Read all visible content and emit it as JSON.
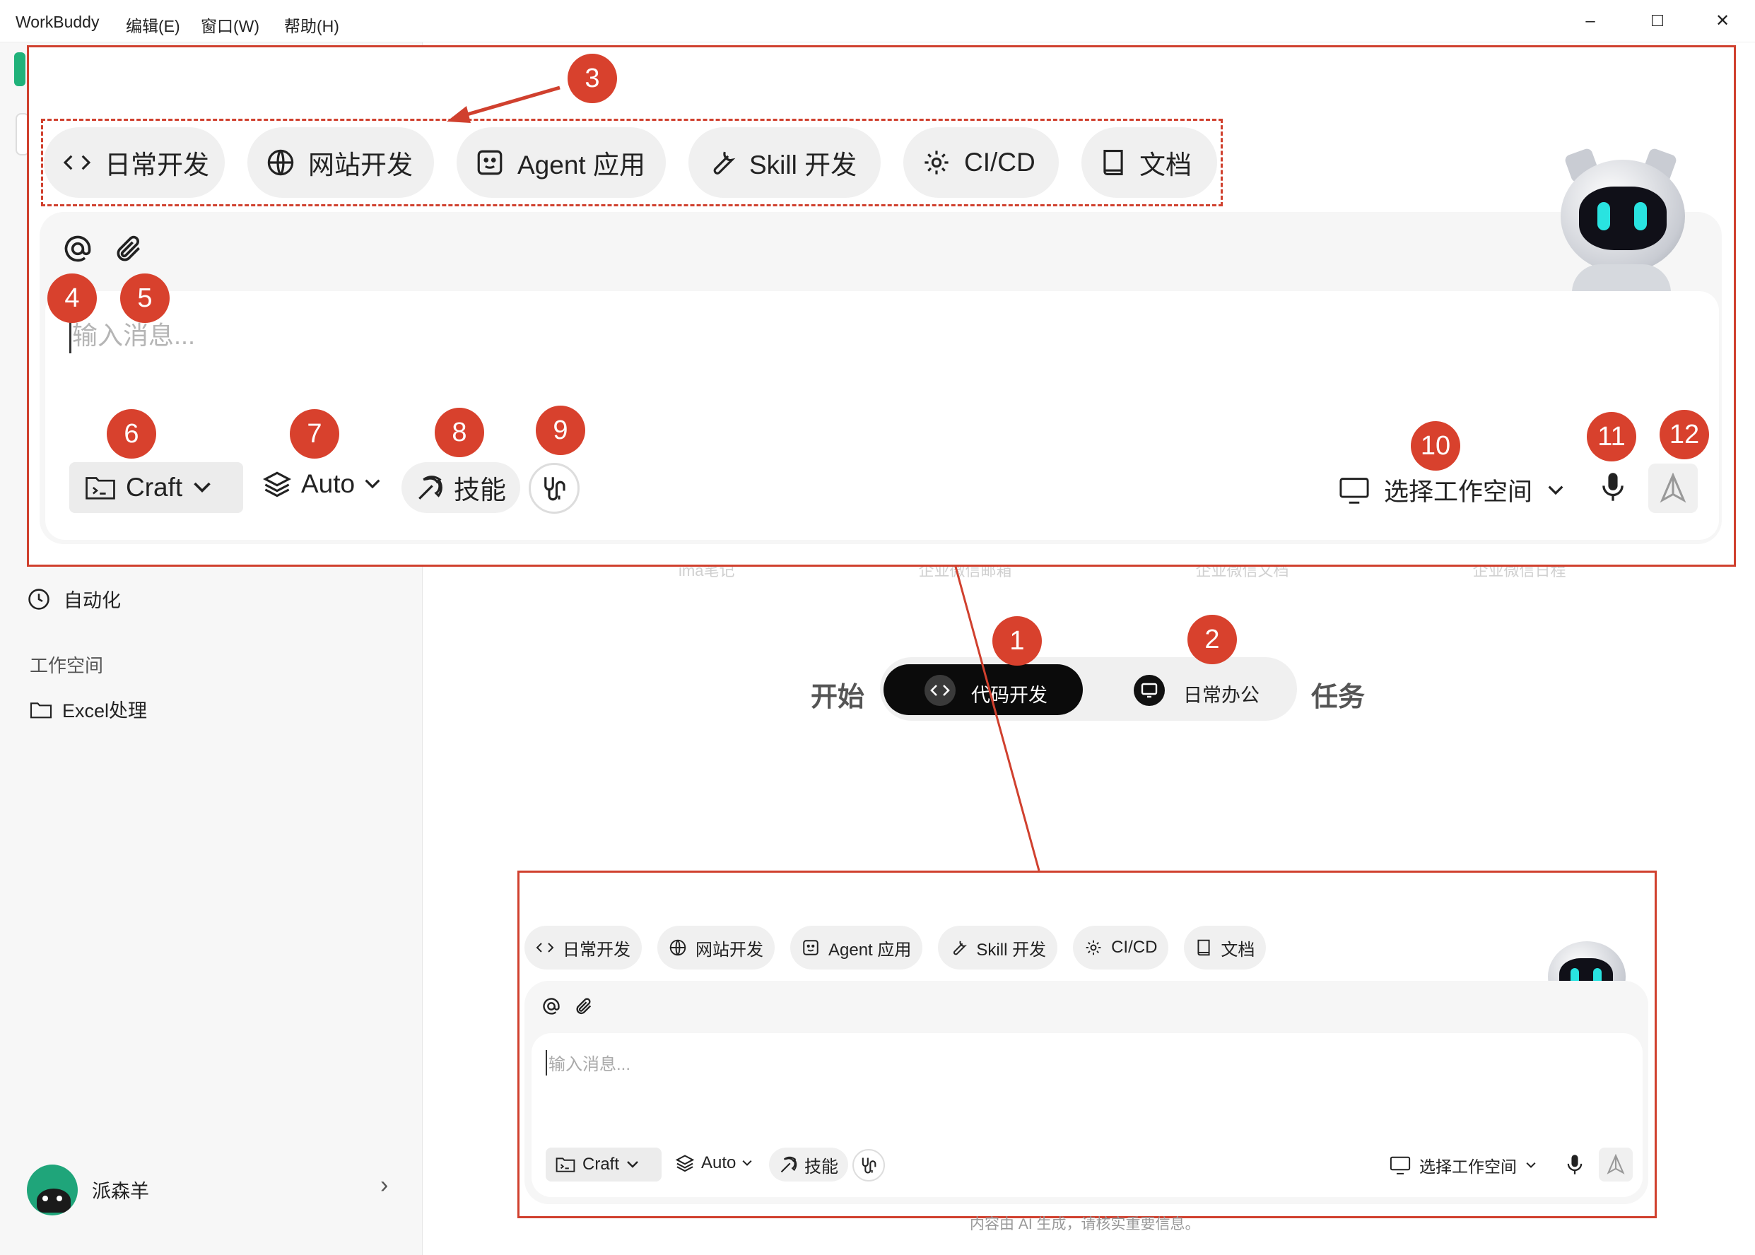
{
  "window": {
    "app_title": "WorkBuddy",
    "menus": [
      "编辑(E)",
      "窗口(W)",
      "帮助(H)"
    ],
    "controls": {
      "minimize": "–",
      "maximize": "☐",
      "close": "✕"
    }
  },
  "sidebar": {
    "automation": "自动化",
    "workspace_section": "工作空间",
    "workspace_folder": "Excel处理",
    "user_name": "派森羊",
    "user_chevron": "›"
  },
  "main": {
    "start_word": "开始",
    "task_word": "任务",
    "mode_dev": "代码开发",
    "mode_office": "日常办公",
    "faded_hints": [
      "ima笔记",
      "企业微信邮箱",
      "企业微信文档",
      "企业微信日程"
    ],
    "disclaimer": "内容由 AI 生成，请核实重要信息。"
  },
  "composer": {
    "chips": [
      "日常开发",
      "网站开发",
      "Agent 应用",
      "Skill 开发",
      "CI/CD",
      "文档"
    ],
    "placeholder": "输入消息...",
    "mode_button": "Craft",
    "model_button": "Auto",
    "skills_button": "技能",
    "workspace_select": "选择工作空间"
  },
  "annotations": {
    "badges": [
      "1",
      "2",
      "3",
      "4",
      "5",
      "6",
      "7",
      "8",
      "9",
      "10",
      "11",
      "12"
    ]
  },
  "colors": {
    "annotation_red": "#d0402e",
    "badge_red": "#d8412d",
    "active_mode_bg": "#0b0b0b",
    "robot_eye": "#29e3e0"
  }
}
